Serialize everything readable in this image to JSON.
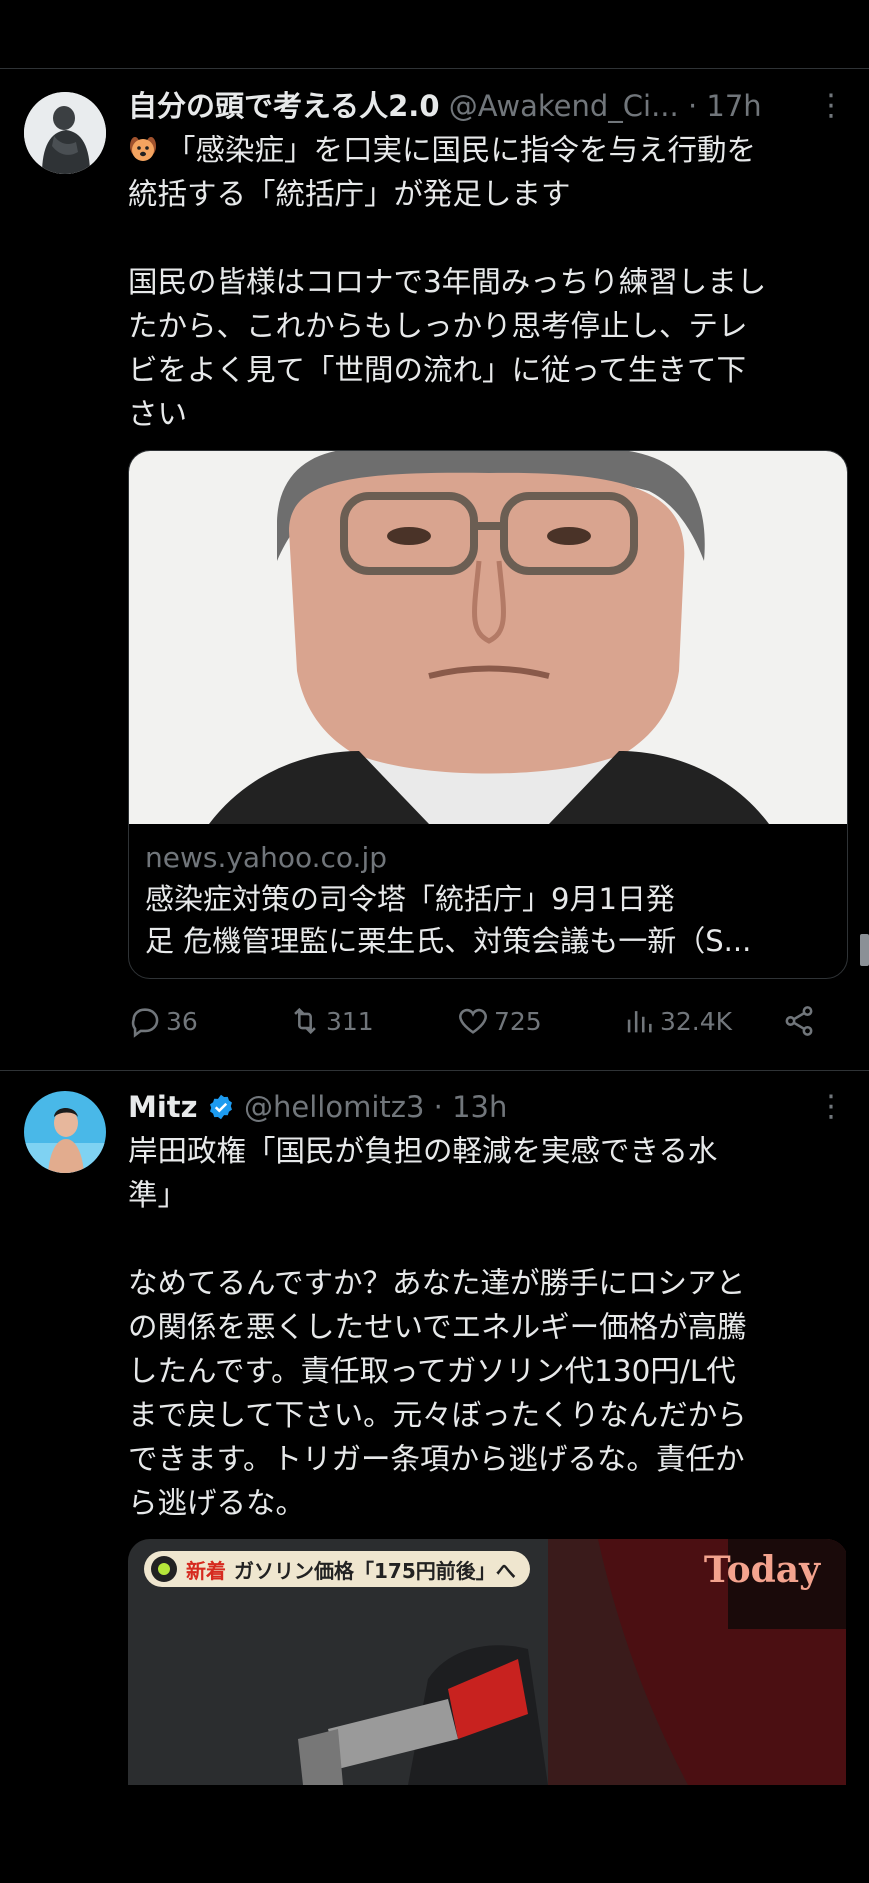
{
  "tweets": [
    {
      "name": "自分の頭で考える人2.0",
      "handle": "@Awakend_Ci...",
      "time": "· 17h",
      "verified": false,
      "text": "「感染症」を口実に国民に指令を与え行動を\n統括する「統括庁」が発足します\n\n国民の皆様はコロナで3年間みっちり練習しまし\nたから、これからもしっかり思考停止し、テレ\nビをよく見て「世間の流れ」に従って生きて下\nさい",
      "link_card": {
        "domain": "news.yahoo.co.jp",
        "title_line1": "感染症対策の司令塔「統括庁」9月1日発",
        "title_line2": "足 危機管理監に栗生氏、対策会議も一新（S..."
      },
      "stats": {
        "replies": "36",
        "retweets": "311",
        "likes": "725",
        "views": "32.4K"
      }
    },
    {
      "name": "Mitz",
      "handle": "@hellomitz3",
      "time": "· 13h",
      "verified": true,
      "text": "岸田政権「国民が負担の軽減を実感できる水\n準」\n\nなめてるんですか？あなた達が勝手にロシアと\nの関係を悪くしたせいでエネルギー価格が高騰\nしたんです。責任取ってガソリン代130円/L代\nまで戻して下さい。元々ぼったくりなんだから\nできます。トリガー条項から逃げるな。責任か\nら逃げるな。",
      "media": {
        "badge": "新着",
        "caption": "ガソリン価格「175円前後」へ",
        "logo": "Today"
      }
    }
  ],
  "colors": {
    "background": "#000000",
    "text": "#e7e9ea",
    "muted": "#71767b",
    "verified": "#1d9bf0",
    "divider": "#2f3336"
  }
}
